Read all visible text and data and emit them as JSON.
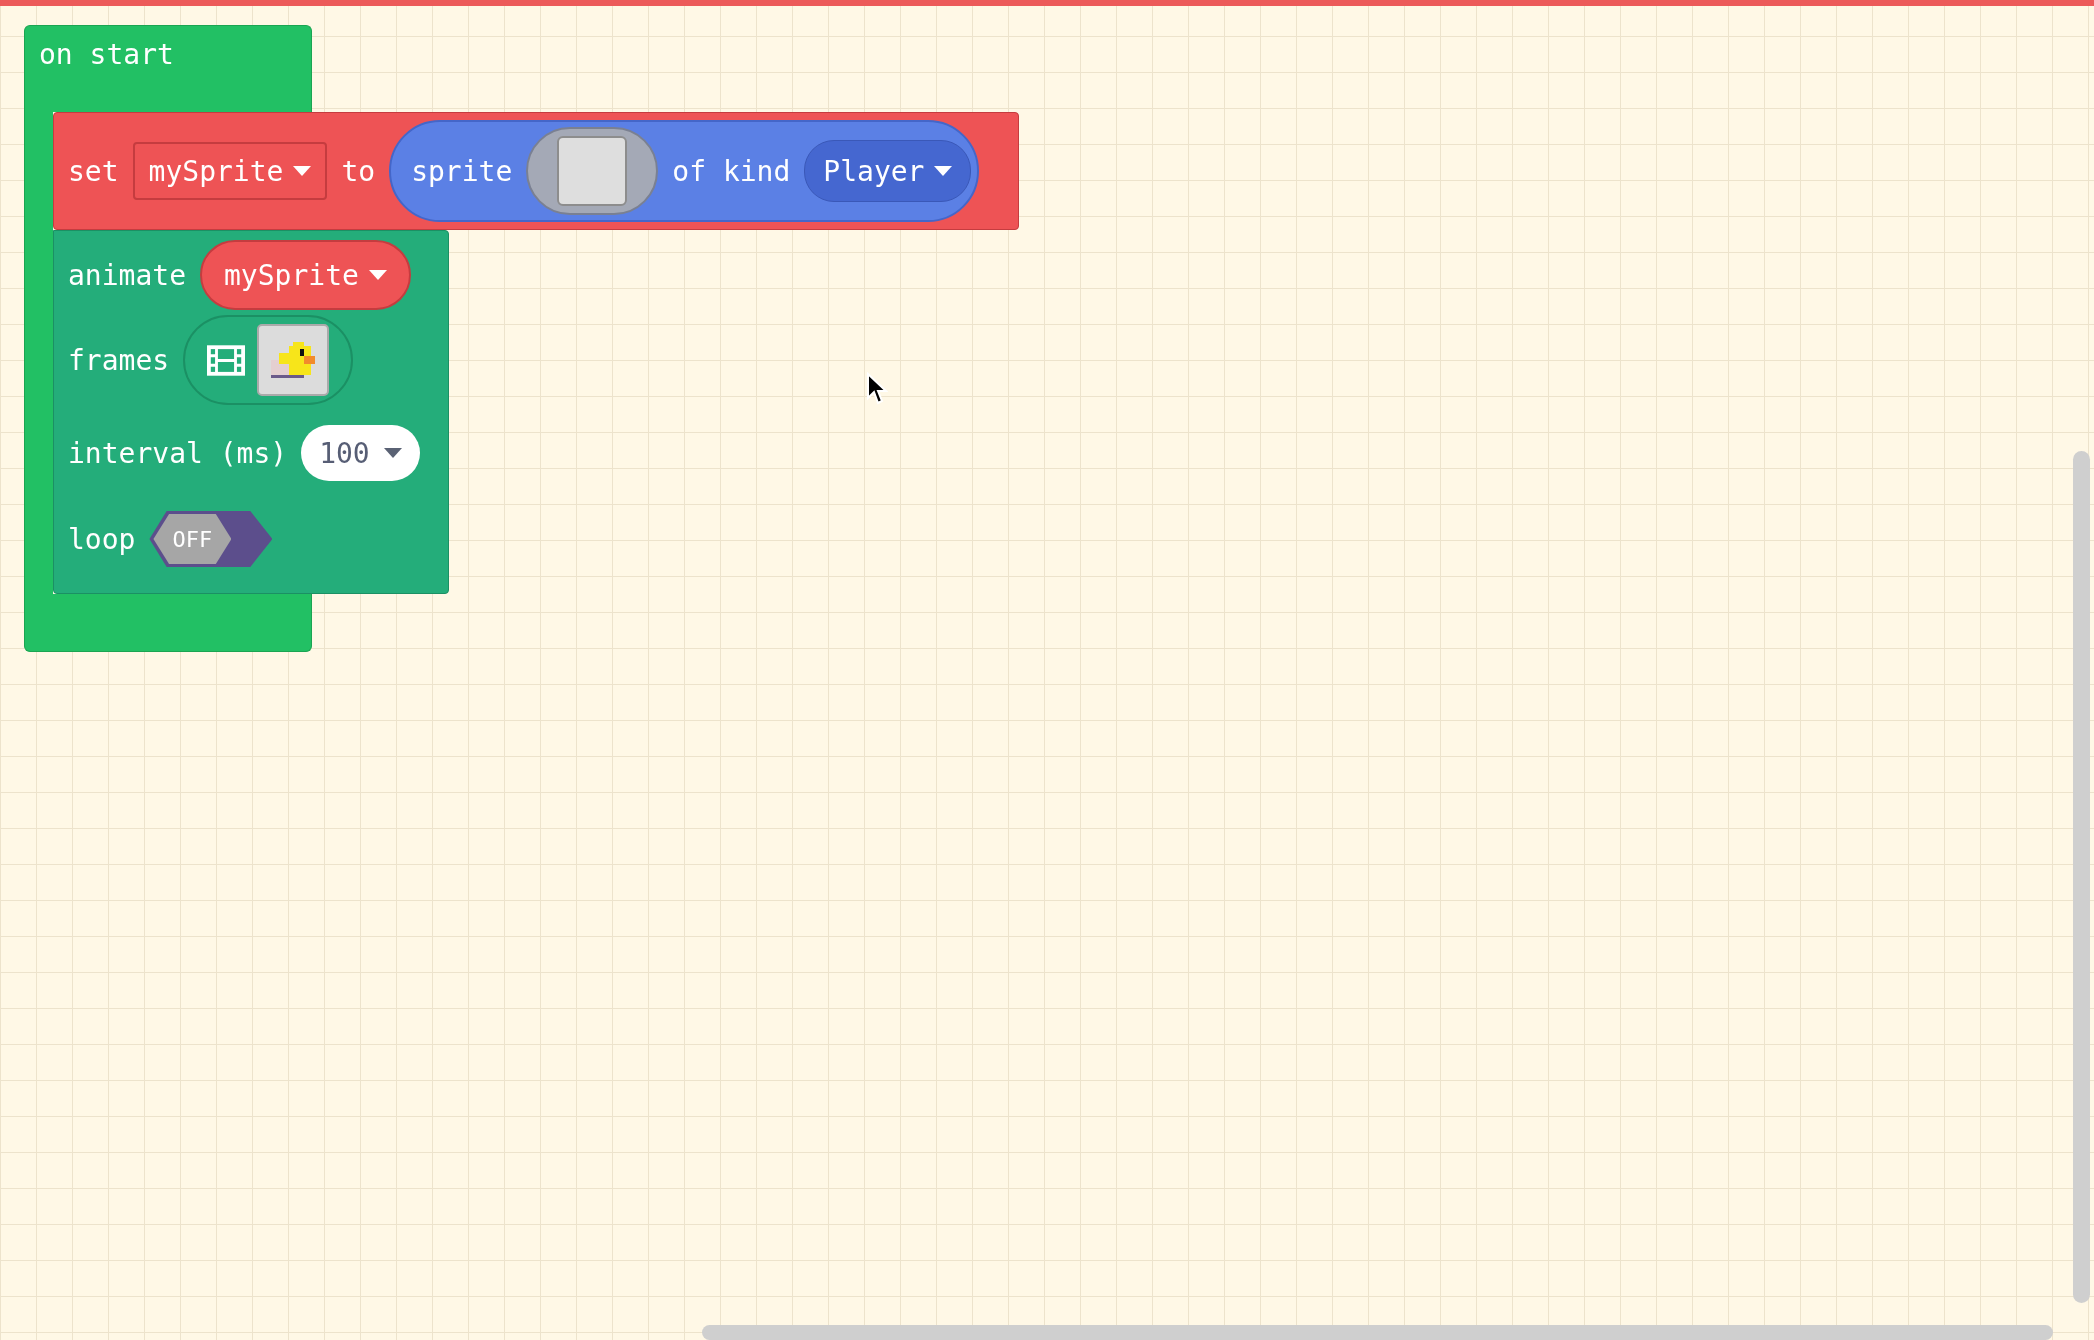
{
  "event_block": {
    "label": "on start"
  },
  "set_block": {
    "keyword": "set",
    "variable": "mySprite",
    "to": "to",
    "sprite_block": {
      "label": "sprite",
      "kind_label": "of kind",
      "kind": "Player"
    }
  },
  "animate_block": {
    "label": "animate",
    "sprite": "mySprite",
    "rows": [
      {
        "kind": "frames",
        "label": "frames"
      },
      {
        "kind": "dropdown",
        "label": "interval (ms)",
        "value": "100"
      },
      {
        "kind": "toggle",
        "label": "loop",
        "on": false,
        "text": "OFF"
      }
    ]
  }
}
